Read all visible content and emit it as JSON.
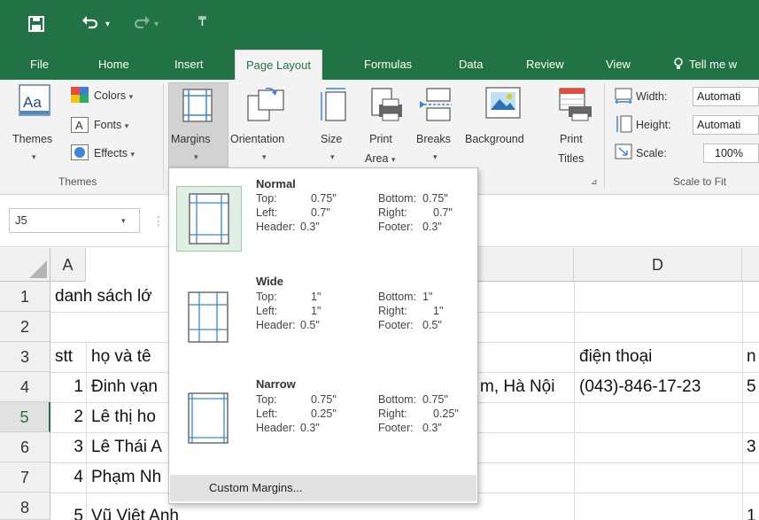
{
  "qat": {
    "save_icon": "save-icon",
    "undo_icon": "undo-icon",
    "redo_icon": "redo-icon",
    "customize_icon": "customize-qat-icon"
  },
  "tabs": [
    {
      "label": "File"
    },
    {
      "label": "Home"
    },
    {
      "label": "Insert"
    },
    {
      "label": "Page Layout",
      "active": true
    },
    {
      "label": "Formulas"
    },
    {
      "label": "Data"
    },
    {
      "label": "Review"
    },
    {
      "label": "View"
    },
    {
      "label": "Tell me w"
    }
  ],
  "ribbon": {
    "themes": {
      "themes_label": "Themes",
      "colors": "Colors",
      "fonts": "Fonts",
      "effects": "Effects",
      "group": "Themes"
    },
    "page_setup": {
      "margins": "Margins",
      "orientation": "Orientation",
      "size": "Size",
      "print_area": "Print",
      "print_area2": "Area",
      "breaks": "Breaks",
      "background": "Background",
      "print_titles": "Print",
      "print_titles2": "Titles"
    },
    "scale_to_fit": {
      "width_label": "Width:",
      "width_value": "Automati",
      "height_label": "Height:",
      "height_value": "Automati",
      "scale_label": "Scale:",
      "scale_value": "100%",
      "group": "Scale to Fit"
    }
  },
  "formula_bar": {
    "name_box": "J5"
  },
  "grid": {
    "columns": [
      {
        "label": "A"
      },
      {
        "label": "D"
      }
    ],
    "rows": [
      "1",
      "2",
      "3",
      "4",
      "5",
      "6",
      "7",
      "8"
    ],
    "selected_row": "5",
    "cells": {
      "r1a": "danh sách lớ",
      "r3a": "stt",
      "r3b": "họ và tê",
      "r3d": "điện thoại",
      "r3e": "n",
      "r4a": "1",
      "r4b": "Đinh vạn",
      "r4c": "m, Hà Nội",
      "r4d": "(043)-846-17-23",
      "r4e": "5",
      "r5a": "2",
      "r5b": "Lê thị ho",
      "r6a": "3",
      "r6b": "Lê Thái A",
      "r6e": "3",
      "r7a": "4",
      "r7b": "Phạm Nh",
      "r8a": "5",
      "r8b": "Vũ Việt Anh",
      "r8e": "1"
    }
  },
  "dropdown": {
    "options": [
      {
        "title": "Normal",
        "top_l": "Top:",
        "top_v": "0.75\"",
        "bottom_l": "Bottom:",
        "bottom_v": "0.75\"",
        "left_l": "Left:",
        "left_v": "0.7\"",
        "right_l": "Right:",
        "right_v": "0.7\"",
        "header_l": "Header:",
        "header_v": "0.3\"",
        "footer_l": "Footer:",
        "footer_v": "0.3\""
      },
      {
        "title": "Wide",
        "top_l": "Top:",
        "top_v": "1\"",
        "bottom_l": "Bottom:",
        "bottom_v": "1\"",
        "left_l": "Left:",
        "left_v": "1\"",
        "right_l": "Right:",
        "right_v": "1\"",
        "header_l": "Header:",
        "header_v": "0.5\"",
        "footer_l": "Footer:",
        "footer_v": "0.5\""
      },
      {
        "title": "Narrow",
        "top_l": "Top:",
        "top_v": "0.75\"",
        "bottom_l": "Bottom:",
        "bottom_v": "0.75\"",
        "left_l": "Left:",
        "left_v": "0.25\"",
        "right_l": "Right:",
        "right_v": "0.25\"",
        "header_l": "Header:",
        "header_v": "0.3\"",
        "footer_l": "Footer:",
        "footer_v": "0.3\""
      }
    ],
    "custom_label": "Custom Margins..."
  },
  "colors": {
    "excel_green": "#217346",
    "ribbon_bg": "#f3f3f3",
    "selected_option": "#e0efe4"
  }
}
